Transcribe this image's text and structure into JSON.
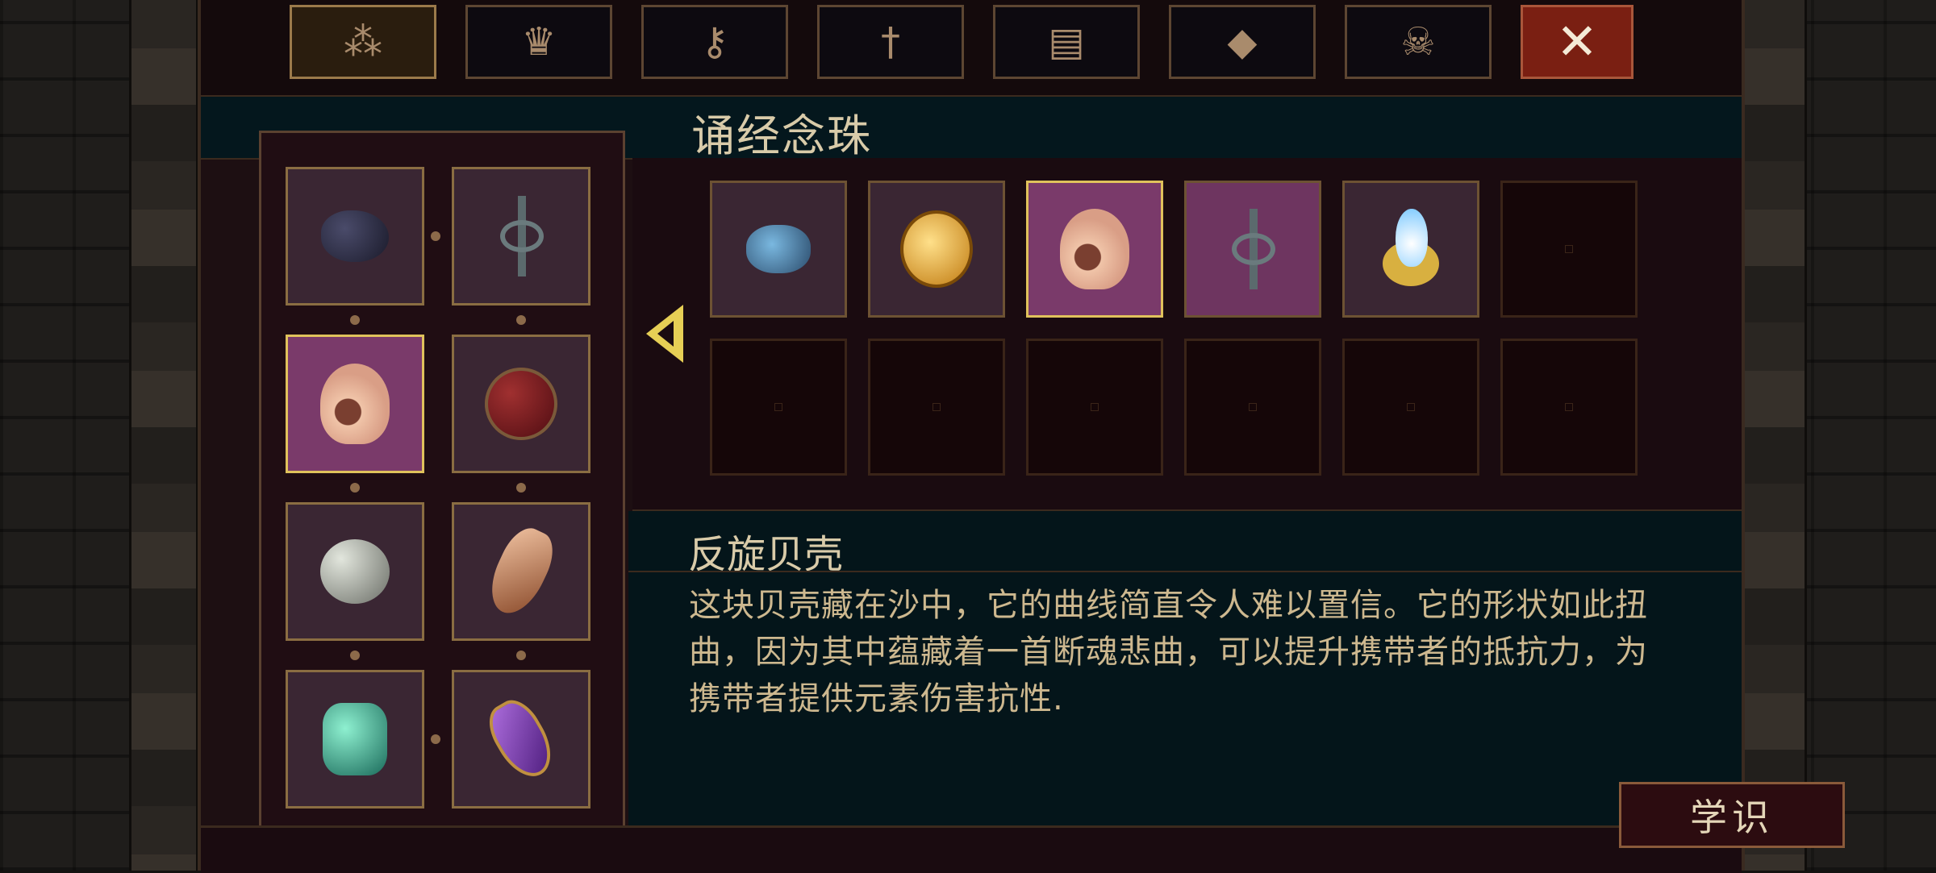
{
  "tabs": [
    {
      "name": "tab-rosary-beads",
      "icon": "beads-icon",
      "active": true
    },
    {
      "name": "tab-relics",
      "icon": "crown-icon",
      "active": false
    },
    {
      "name": "tab-keys",
      "icon": "key-icon",
      "active": false
    },
    {
      "name": "tab-weapon",
      "icon": "sword-icon",
      "active": false
    },
    {
      "name": "tab-book",
      "icon": "book-icon",
      "active": false
    },
    {
      "name": "tab-prayers",
      "icon": "diamond-icon",
      "active": false
    },
    {
      "name": "tab-skulls",
      "icon": "skull-icon",
      "active": false
    },
    {
      "name": "tab-close",
      "icon": "close-icon",
      "glyph": "✕",
      "active": false
    }
  ],
  "section_title": "诵经念珠",
  "equipped": [
    {
      "item": "black-rock"
    },
    {
      "item": "iron-cross"
    },
    {
      "item": "spiral-shell",
      "selected": true
    },
    {
      "item": "red-sphere"
    },
    {
      "item": "grey-pearl"
    },
    {
      "item": "feather-charm"
    },
    {
      "item": "green-gem"
    },
    {
      "item": "purple-amulet"
    }
  ],
  "inventory_rows": [
    [
      {
        "item": "blue-stone"
      },
      {
        "item": "gold-coin"
      },
      {
        "item": "spiral-shell",
        "selected": true
      },
      {
        "item": "iron-cross"
      },
      {
        "item": "white-flame-orb"
      },
      {
        "item": ""
      }
    ],
    [
      {
        "item": ""
      },
      {
        "item": ""
      },
      {
        "item": ""
      },
      {
        "item": ""
      },
      {
        "item": ""
      },
      {
        "item": ""
      }
    ]
  ],
  "description": {
    "title": "反旋贝壳",
    "text": "这块贝壳藏在沙中，它的曲线简直令人难以置信。它的形状如此扭曲，因为其中蕴藏着一首断魂悲曲，可以提升携带者的抵抗力，为携带者提供元素伤害抗性."
  },
  "learn_button": "学识",
  "colors": {
    "panel": "#1d0f12",
    "selected": "#7a3a6a",
    "border_gold": "#e0c25c",
    "text": "#d9cba9"
  }
}
